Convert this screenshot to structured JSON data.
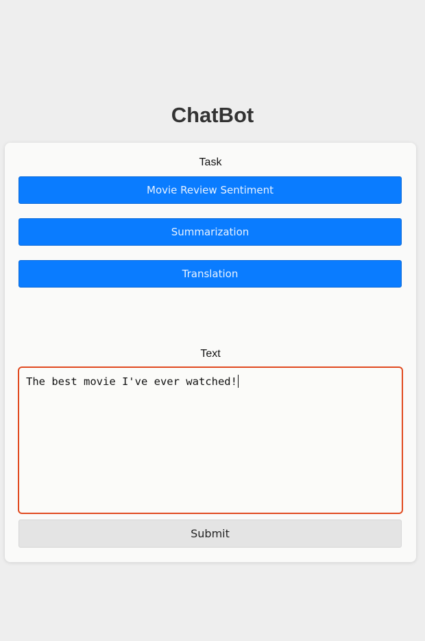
{
  "header": {
    "title": "ChatBot"
  },
  "task": {
    "label": "Task",
    "buttons": [
      {
        "label": "Movie Review Sentiment"
      },
      {
        "label": "Summarization"
      },
      {
        "label": "Translation"
      }
    ]
  },
  "text": {
    "label": "Text",
    "value": "The best movie I've ever watched!"
  },
  "submit": {
    "label": "Submit"
  },
  "colors": {
    "accent": "#0a7cff",
    "focus_border": "#e0491f",
    "background": "#eeeeee"
  }
}
